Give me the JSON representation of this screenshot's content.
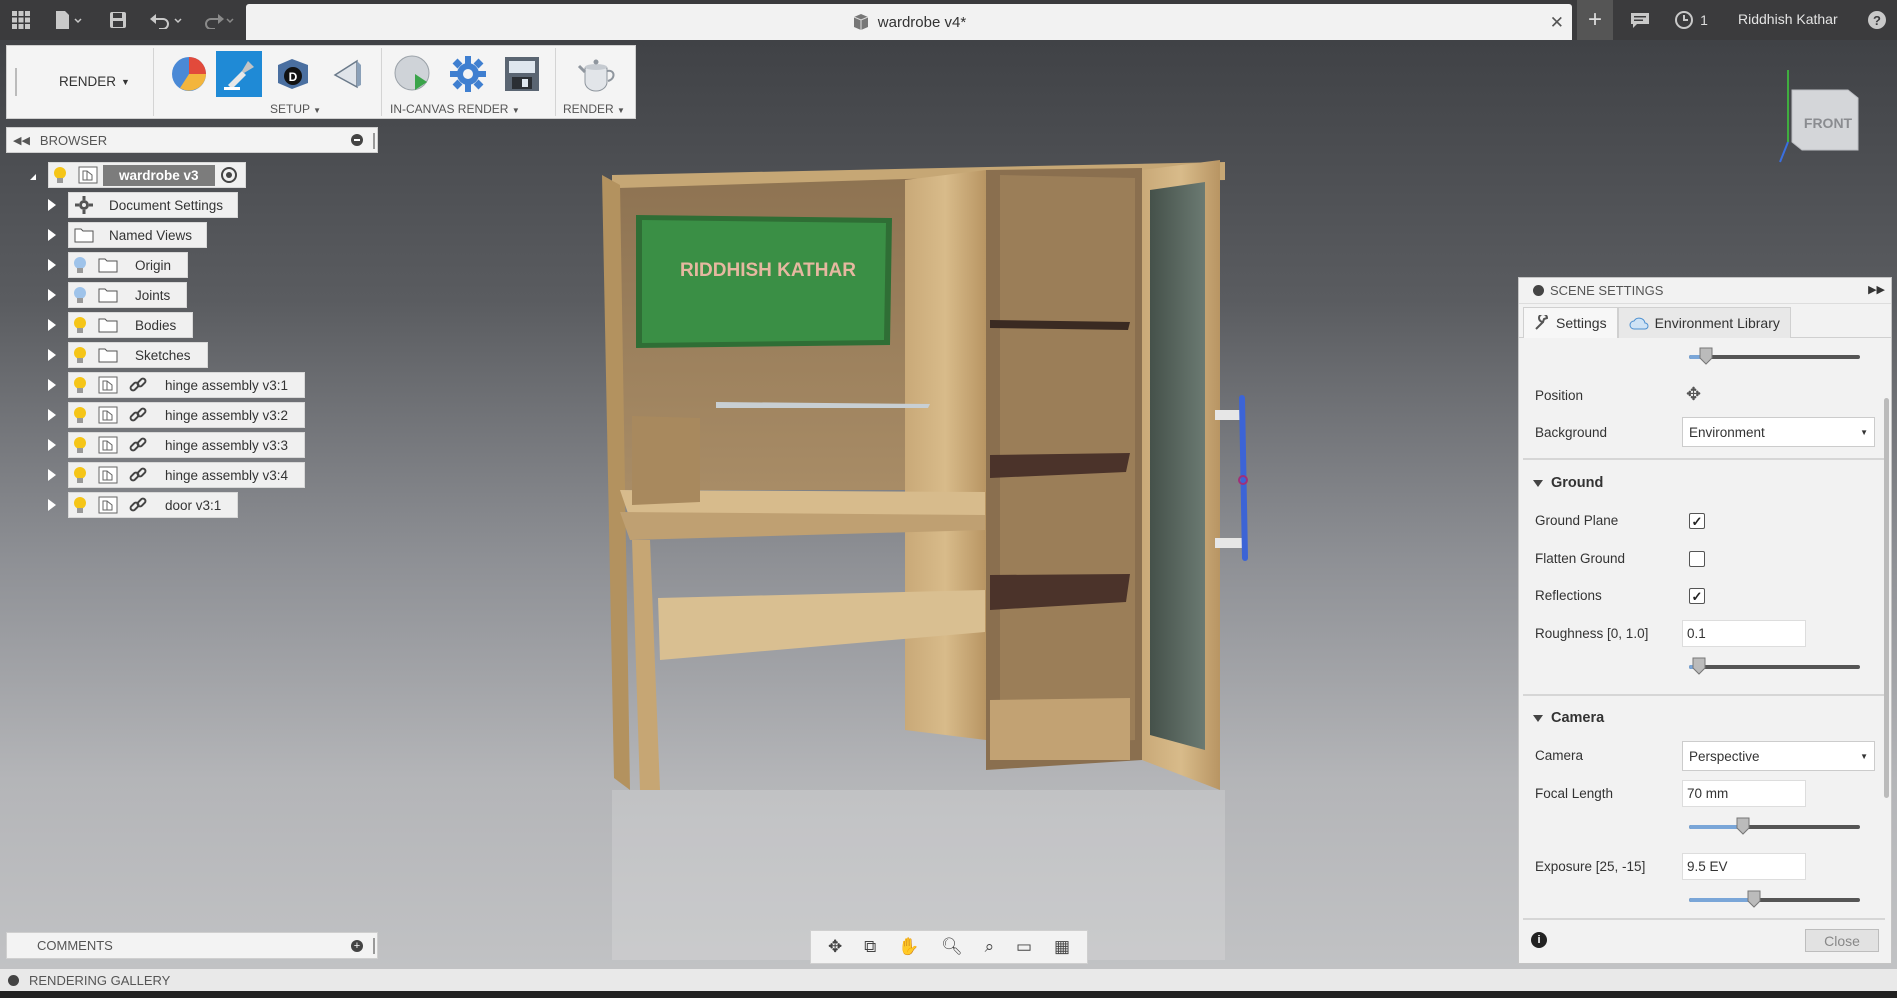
{
  "app": {
    "document_title": "wardrobe v4*",
    "job_count": "1",
    "user_name": "Riddhish Kathar"
  },
  "toolbar": {
    "workspace_label": "RENDER",
    "groups": {
      "setup": "SETUP",
      "in_canvas": "IN-CANVAS RENDER",
      "render": "RENDER"
    }
  },
  "browser": {
    "title": "BROWSER",
    "root": "wardrobe v3",
    "items": [
      {
        "label": "Document Settings",
        "icon": "gear-icon"
      },
      {
        "label": "Named Views",
        "icon": "folder-icon"
      },
      {
        "label": "Origin",
        "icon": "folder-icon"
      },
      {
        "label": "Joints",
        "icon": "folder-icon"
      },
      {
        "label": "Bodies",
        "icon": "folder-icon"
      },
      {
        "label": "Sketches",
        "icon": "folder-icon"
      },
      {
        "label": "hinge assembly v3:1",
        "icon": "component-icon"
      },
      {
        "label": "hinge assembly v3:2",
        "icon": "component-icon"
      },
      {
        "label": "hinge assembly v3:3",
        "icon": "component-icon"
      },
      {
        "label": "hinge assembly v3:4",
        "icon": "component-icon"
      },
      {
        "label": "door v3:1",
        "icon": "component-icon"
      }
    ]
  },
  "viewport": {
    "board_text": "RIDDHISH KATHAR",
    "viewcube_face": "FRONT"
  },
  "scene_settings": {
    "title": "SCENE SETTINGS",
    "tabs": [
      "Settings",
      "Environment Library"
    ],
    "position_label": "Position",
    "background_label": "Background",
    "background_value": "Environment",
    "ground_section": "Ground",
    "ground_plane_label": "Ground Plane",
    "ground_plane_checked": true,
    "flatten_ground_label": "Flatten Ground",
    "flatten_ground_checked": false,
    "reflections_label": "Reflections",
    "reflections_checked": true,
    "roughness_label": "Roughness [0, 1.0]",
    "roughness_value": "0.1",
    "camera_section": "Camera",
    "camera_label": "Camera",
    "camera_value": "Perspective",
    "focal_length_label": "Focal Length",
    "focal_length_value": "70 mm",
    "exposure_label": "Exposure [25, -15]",
    "exposure_value": "9.5 EV",
    "close_label": "Close"
  },
  "comments": {
    "title": "COMMENTS"
  },
  "rendering_gallery": {
    "title": "RENDERING GALLERY"
  },
  "colors": {
    "accent": "#1f8ad6",
    "topbar": "#3b3b3d",
    "board": "#3a8f45"
  }
}
